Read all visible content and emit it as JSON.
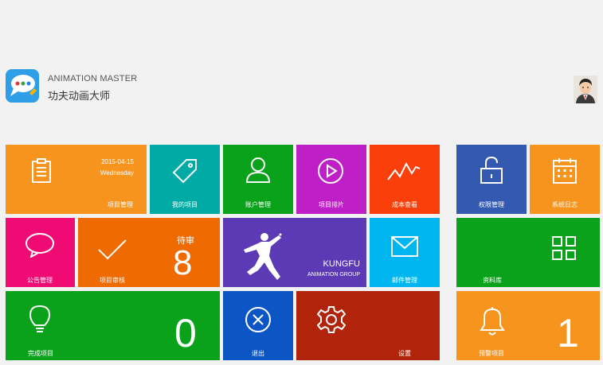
{
  "header": {
    "title_en": "ANIMATION MASTER",
    "title_cn": "功夫动画大师",
    "logo_icon": "chat-bubble-dots-icon",
    "avatar_icon": "user-avatar-icon"
  },
  "colors": {
    "orange": "#f7941e",
    "teal": "#00aaa5",
    "green": "#0aa21a",
    "magenta": "#bf1fc6",
    "red_orange": "#fa3f0a",
    "blue": "#3459b1",
    "pink": "#f00b74",
    "dark_orange": "#ef6a00",
    "purple": "#5c3ab5",
    "sky_blue": "#00b6f0",
    "royal_blue": "#0c55c4",
    "dark_red": "#b1240b"
  },
  "tiles": {
    "project_management": {
      "label": "项目管理",
      "date": "2015-04-15",
      "weekday": "Wednesday",
      "icon": "clipboard-icon"
    },
    "my_projects": {
      "label": "我的项目",
      "icon": "tag-icon"
    },
    "account_management": {
      "label": "账户管理",
      "icon": "user-icon"
    },
    "project_schedule": {
      "label": "项目排片",
      "icon": "play-icon"
    },
    "cost_view": {
      "label": "成本查看",
      "icon": "line-chart-icon"
    },
    "permission_management": {
      "label": "权限管理",
      "icon": "unlock-icon"
    },
    "system_log": {
      "label": "系统日志",
      "icon": "calendar-icon"
    },
    "announcement_management": {
      "label": "公告管理",
      "icon": "speech-bubble-icon"
    },
    "project_review": {
      "label": "项目审核",
      "pending_label": "待审",
      "pending_count": "8",
      "icon": "checkmark-icon"
    },
    "kungfu": {
      "line1": "KUNGFU",
      "line2": "ANIMATION GROUP",
      "icon": "kungfu-figure-icon"
    },
    "mail_management": {
      "label": "邮件管理",
      "icon": "envelope-icon"
    },
    "library": {
      "label": "资料库",
      "icon": "grid-icon"
    },
    "completed_projects": {
      "label": "完成项目",
      "count": "0",
      "icon": "lightbulb-icon"
    },
    "logout": {
      "label": "退出",
      "icon": "close-circle-icon"
    },
    "settings": {
      "label": "设置",
      "icon": "gear-icon"
    },
    "warning_projects": {
      "label": "预警项目",
      "count": "1",
      "icon": "bell-icon"
    }
  }
}
